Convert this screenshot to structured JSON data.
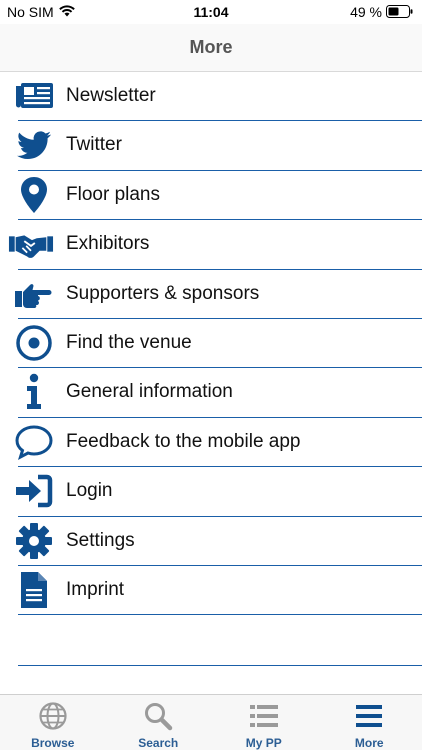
{
  "status_bar": {
    "carrier": "No SIM",
    "time": "11:04",
    "battery": "49 %"
  },
  "nav": {
    "title": "More"
  },
  "menu": {
    "items": [
      {
        "label": "Newsletter",
        "icon": "newspaper-icon"
      },
      {
        "label": "Twitter",
        "icon": "twitter-icon"
      },
      {
        "label": "Floor plans",
        "icon": "map-pin-icon"
      },
      {
        "label": "Exhibitors",
        "icon": "handshake-icon"
      },
      {
        "label": "Supporters & sponsors",
        "icon": "hand-pointing-icon"
      },
      {
        "label": "Find the venue",
        "icon": "target-icon"
      },
      {
        "label": "General information",
        "icon": "info-icon"
      },
      {
        "label": "Feedback to the mobile app",
        "icon": "speech-bubble-icon"
      },
      {
        "label": "Login",
        "icon": "sign-in-icon"
      },
      {
        "label": "Settings",
        "icon": "gear-icon"
      },
      {
        "label": "Imprint",
        "icon": "document-icon"
      }
    ]
  },
  "tabs": [
    {
      "label": "Browse",
      "icon": "globe-icon"
    },
    {
      "label": "Search",
      "icon": "search-icon"
    },
    {
      "label": "My PP",
      "icon": "list-icon"
    },
    {
      "label": "More",
      "icon": "hamburger-icon"
    }
  ],
  "colors": {
    "accent": "#0f4f8f",
    "divider": "#1a5fa8",
    "tab_inactive": "#9a9a9a",
    "tab_label": "#2c5e94"
  }
}
